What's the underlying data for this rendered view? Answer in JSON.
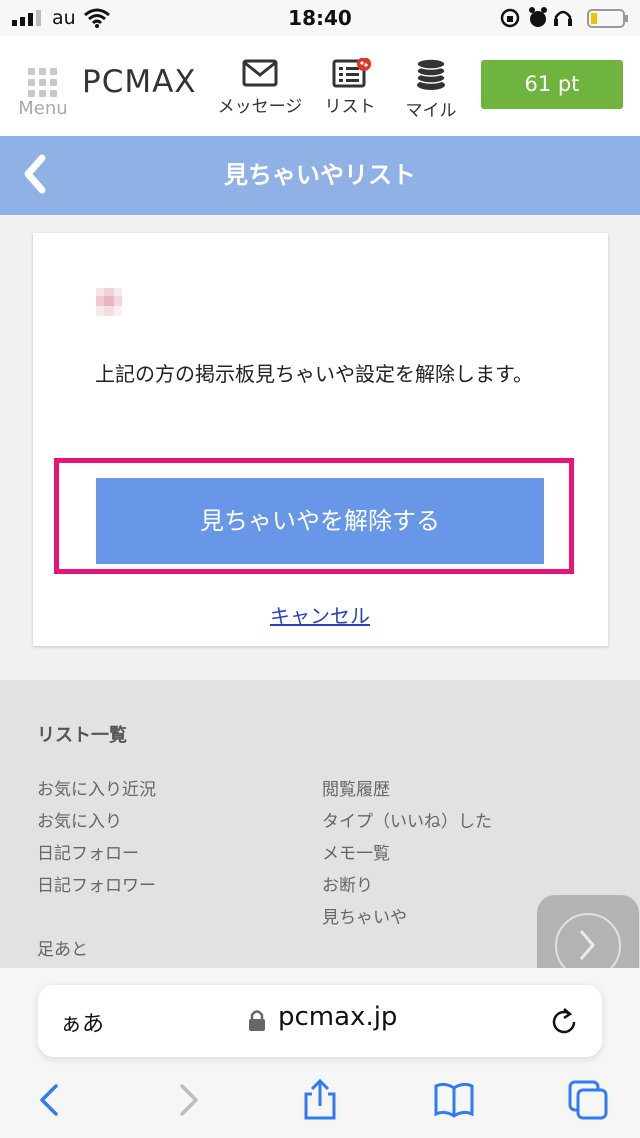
{
  "status_bar": {
    "carrier": "au",
    "time": "18:40"
  },
  "header": {
    "menu_label": "Menu",
    "logo": "PCMAX",
    "nav": [
      {
        "label": "メッセージ",
        "icon": "envelope-icon"
      },
      {
        "label": "リスト",
        "icon": "list-icon"
      },
      {
        "label": "マイル",
        "icon": "coins-icon"
      }
    ],
    "points": "61 pt"
  },
  "title_bar": {
    "title": "見ちゃいやリスト"
  },
  "card": {
    "notice": "上記の方の掲示板見ちゃいや設定を解除します。",
    "release_button": "見ちゃいやを解除する",
    "cancel_link": "キャンセル"
  },
  "footer": {
    "heading": "リスト一覧",
    "left_items": [
      "お気に入り近況",
      "お気に入り",
      "日記フォロー",
      "日記フォロワー"
    ],
    "right_items": [
      "閲覧履歴",
      "タイプ（いいね）した",
      "メモ一覧",
      "お断り",
      "見ちゃいや"
    ],
    "footprints": "足あと"
  },
  "browser": {
    "aa_label": "ぁあ",
    "url": "pcmax.jp"
  },
  "colors": {
    "title_bar": "#8fb1e6",
    "release_button": "#6797e6",
    "highlight_border": "#e5157a",
    "points_button": "#6eb43f",
    "link": "#2b3fc5"
  }
}
